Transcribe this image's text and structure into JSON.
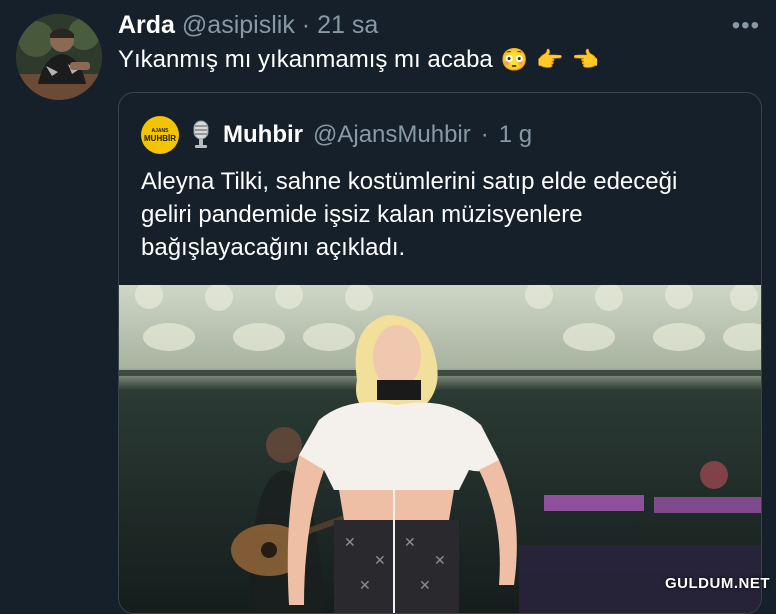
{
  "tweet": {
    "name": "Arda",
    "handle": "@asipislik",
    "separator": "·",
    "time": "21 sa",
    "more_icon": "more-horizontal-icon",
    "text": "Yıkanmış mı yıkanmamış mı acaba",
    "emojis": [
      "😳",
      "👉",
      "👈"
    ]
  },
  "quoted": {
    "logo_line1": "AJANS",
    "logo_line2": "MUHBİR",
    "mic_icon": "microphone-icon",
    "name": "Muhbir",
    "handle": "@AjansMuhbir",
    "separator": "·",
    "time": "1 g",
    "text": "Aleyna Tilki, sahne kostümlerini satıp elde edeceği geliri pandemide işsiz kalan müzisyenlere bağışlayacağını açıkladı."
  },
  "watermark": "GULDUM.NET",
  "colors": {
    "background": "#15202b",
    "border": "#38444d",
    "muted_text": "#8899a6",
    "logo_yellow": "#f5c400"
  }
}
